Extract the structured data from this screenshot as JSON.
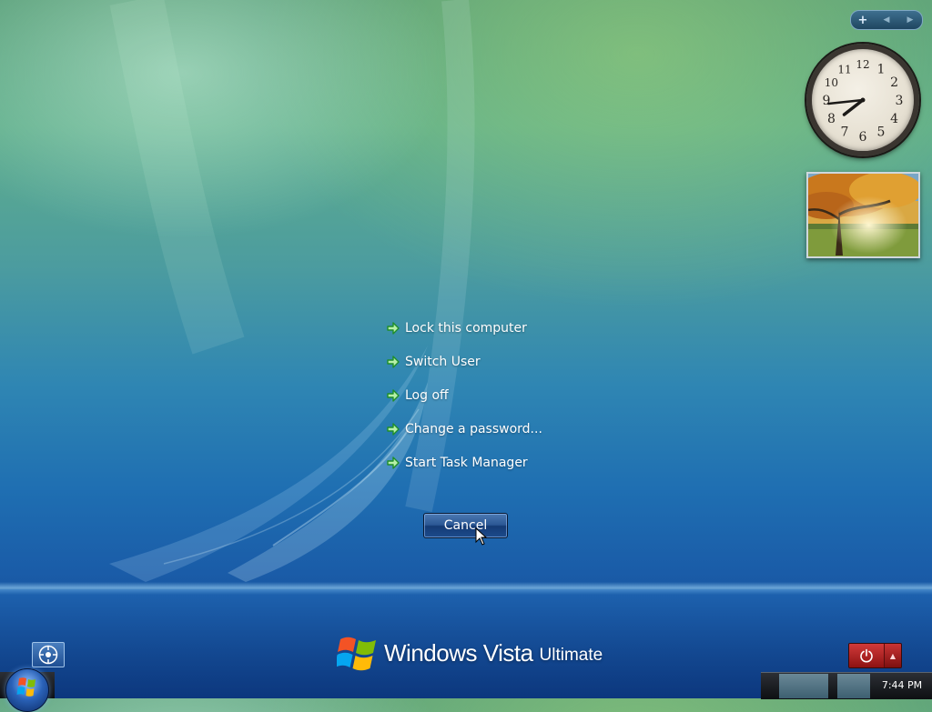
{
  "menu": {
    "items": [
      {
        "label": "Lock this computer"
      },
      {
        "label": "Switch User"
      },
      {
        "label": "Log off"
      },
      {
        "label": "Change a password..."
      },
      {
        "label": "Start Task Manager"
      }
    ]
  },
  "cancel_button": {
    "label": "Cancel"
  },
  "branding": {
    "product": "Windows Vista",
    "edition": "Ultimate"
  },
  "sidebar": {
    "toolbar": {
      "add_label": "+"
    },
    "clock_gadget": {
      "hour": 7,
      "minute": 44,
      "numerals": [
        "12",
        "1",
        "2",
        "3",
        "4",
        "5",
        "6",
        "7",
        "8",
        "9",
        "10",
        "11"
      ]
    },
    "slideshow_gadget": {
      "image": "autumn-tree-landscape"
    }
  },
  "taskbar": {
    "time": "7:44 PM"
  },
  "icons": {
    "menu_arrow": "green-arrow-icon",
    "ease_of_access": "ease-of-access-icon",
    "power": "power-icon",
    "power_options": "up-arrow-icon",
    "start": "windows-orb-icon",
    "cursor": "mouse-pointer-icon"
  },
  "colors": {
    "menu_arrow_green": "#2fbf3a",
    "power_red": "#b82222",
    "cancel_blue": "#1c4b8c"
  }
}
